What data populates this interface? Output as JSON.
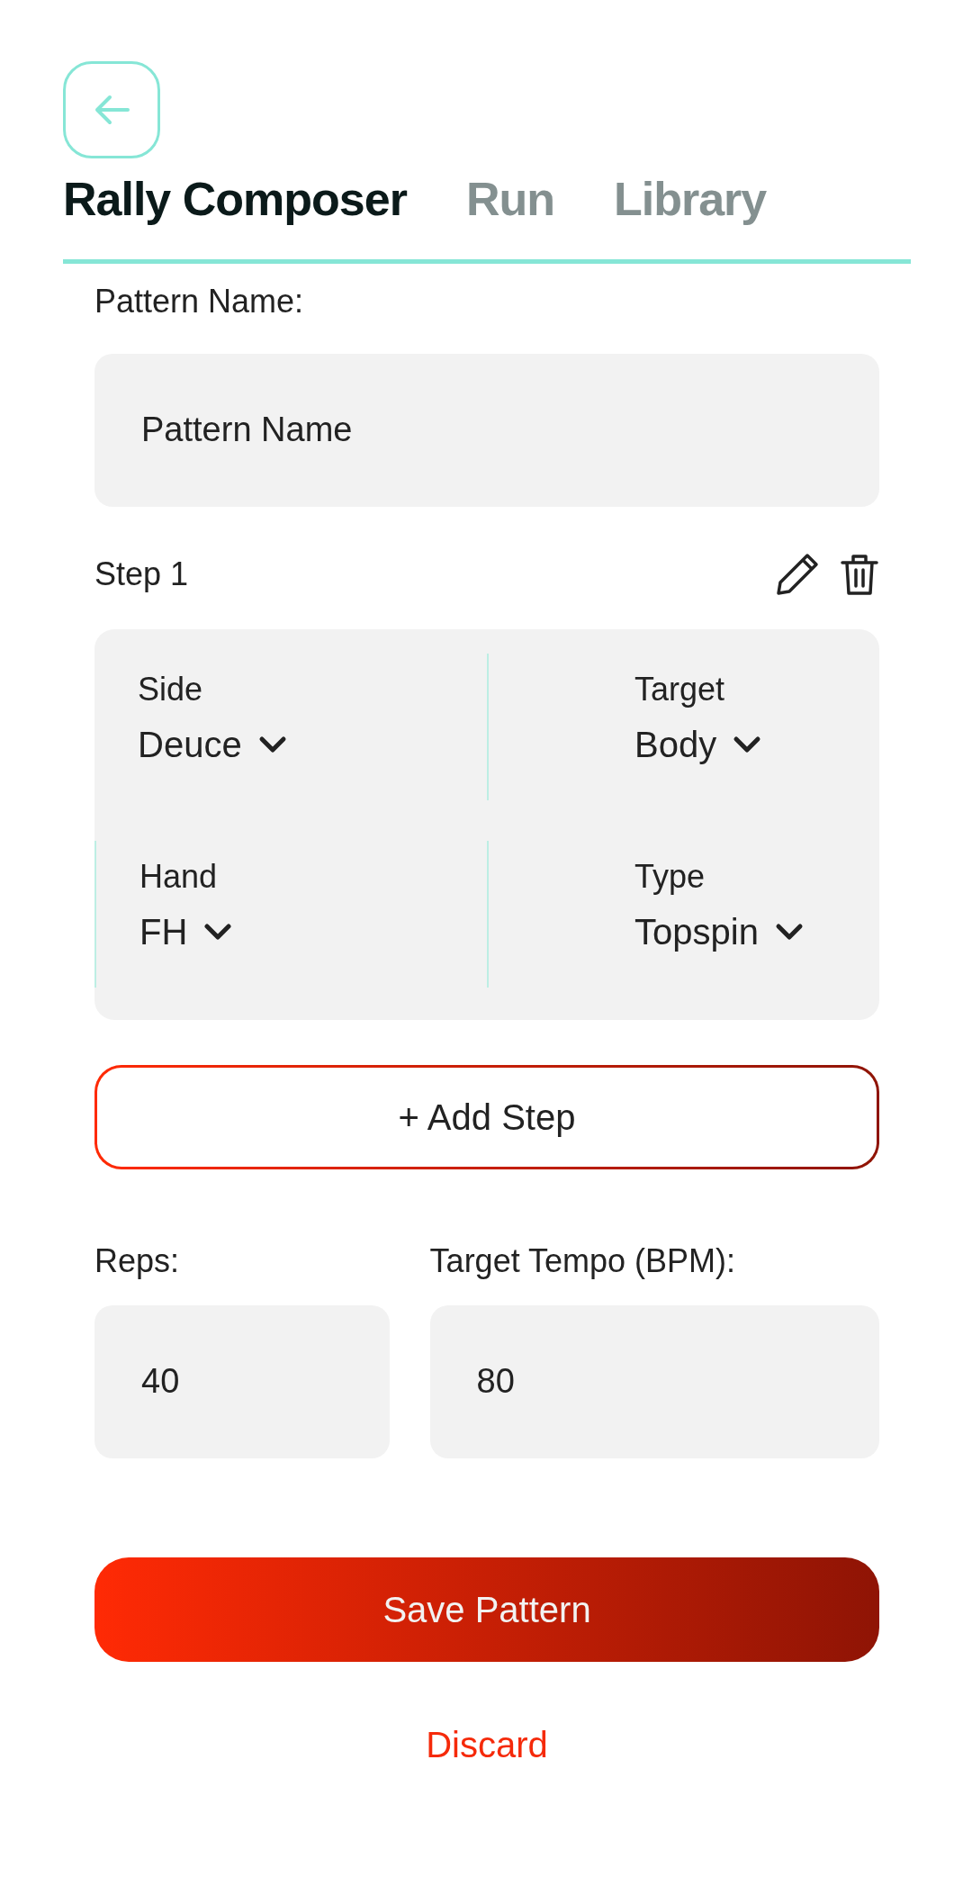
{
  "tabs": [
    {
      "label": "Rally Composer",
      "selected": true
    },
    {
      "label": "Run",
      "selected": false
    },
    {
      "label": "Library",
      "selected": false
    }
  ],
  "pattern_name": {
    "label": "Pattern Name:",
    "placeholder": "Pattern Name"
  },
  "steps": [
    {
      "title": "Step 1",
      "fields": [
        {
          "label": "Side",
          "value": "Deuce"
        },
        {
          "label": "Target",
          "value": "Body"
        },
        {
          "label": "Hand",
          "value": "FH"
        },
        {
          "label": "Type",
          "value": "Topspin"
        }
      ]
    }
  ],
  "add_step": "+ Add Step",
  "reps": {
    "label": "Reps:",
    "value": "40"
  },
  "tempo": {
    "label": "Target Tempo (BPM):",
    "value": "80"
  },
  "save": "Save Pattern",
  "discard": "Discard"
}
